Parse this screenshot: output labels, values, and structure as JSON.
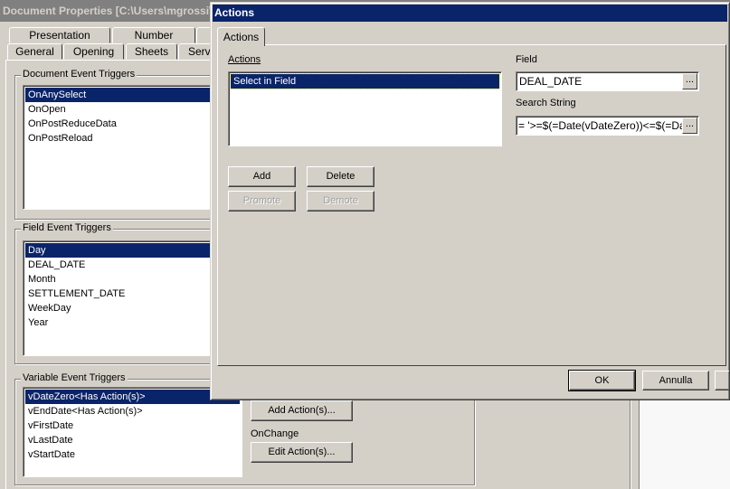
{
  "back_window": {
    "title": "Document Properties [C:\\Users\\mgrossi\\",
    "tabs_row1": [
      "Presentation",
      "Number",
      ""
    ],
    "tabs_row2": [
      "General",
      "Opening",
      "Sheets",
      "Serve"
    ],
    "document_triggers": {
      "label": "Document Event Triggers",
      "items": [
        "OnAnySelect",
        "OnOpen",
        "OnPostReduceData",
        "OnPostReload"
      ],
      "selected": 0
    },
    "field_triggers": {
      "label": "Field Event Triggers",
      "items": [
        "Day",
        "DEAL_DATE",
        "Month",
        "SETTLEMENT_DATE",
        "WeekDay",
        "Year"
      ],
      "selected": 0
    },
    "variable_triggers": {
      "label": "Variable Event Triggers",
      "items": [
        "vDateZero<Has Action(s)>",
        "vEndDate<Has Action(s)>",
        "vFirstDate",
        "vLastDate",
        "vStartDate"
      ],
      "selected": 0
    },
    "add_actions_label": "Add Action(s)...",
    "onchange_label": "OnChange",
    "edit_actions_label": "Edit Action(s)..."
  },
  "actions_dialog": {
    "title": "Actions",
    "tab": "Actions",
    "actions_label": "Actions",
    "actions_items": [
      "Select in Field"
    ],
    "field_label": "Field",
    "field_value": "DEAL_DATE",
    "search_label": "Search String",
    "search_value": "= '>=$(=Date(vDateZero))<=$(=Da",
    "browse_label": "...",
    "add": "Add",
    "delete": "Delete",
    "promote": "Promote",
    "demote": "Demote",
    "ok": "OK",
    "cancel": "Annulla"
  },
  "colors": {
    "selection": "#0a246a",
    "face": "#d4d0c8",
    "inactive_title": "#808080"
  }
}
